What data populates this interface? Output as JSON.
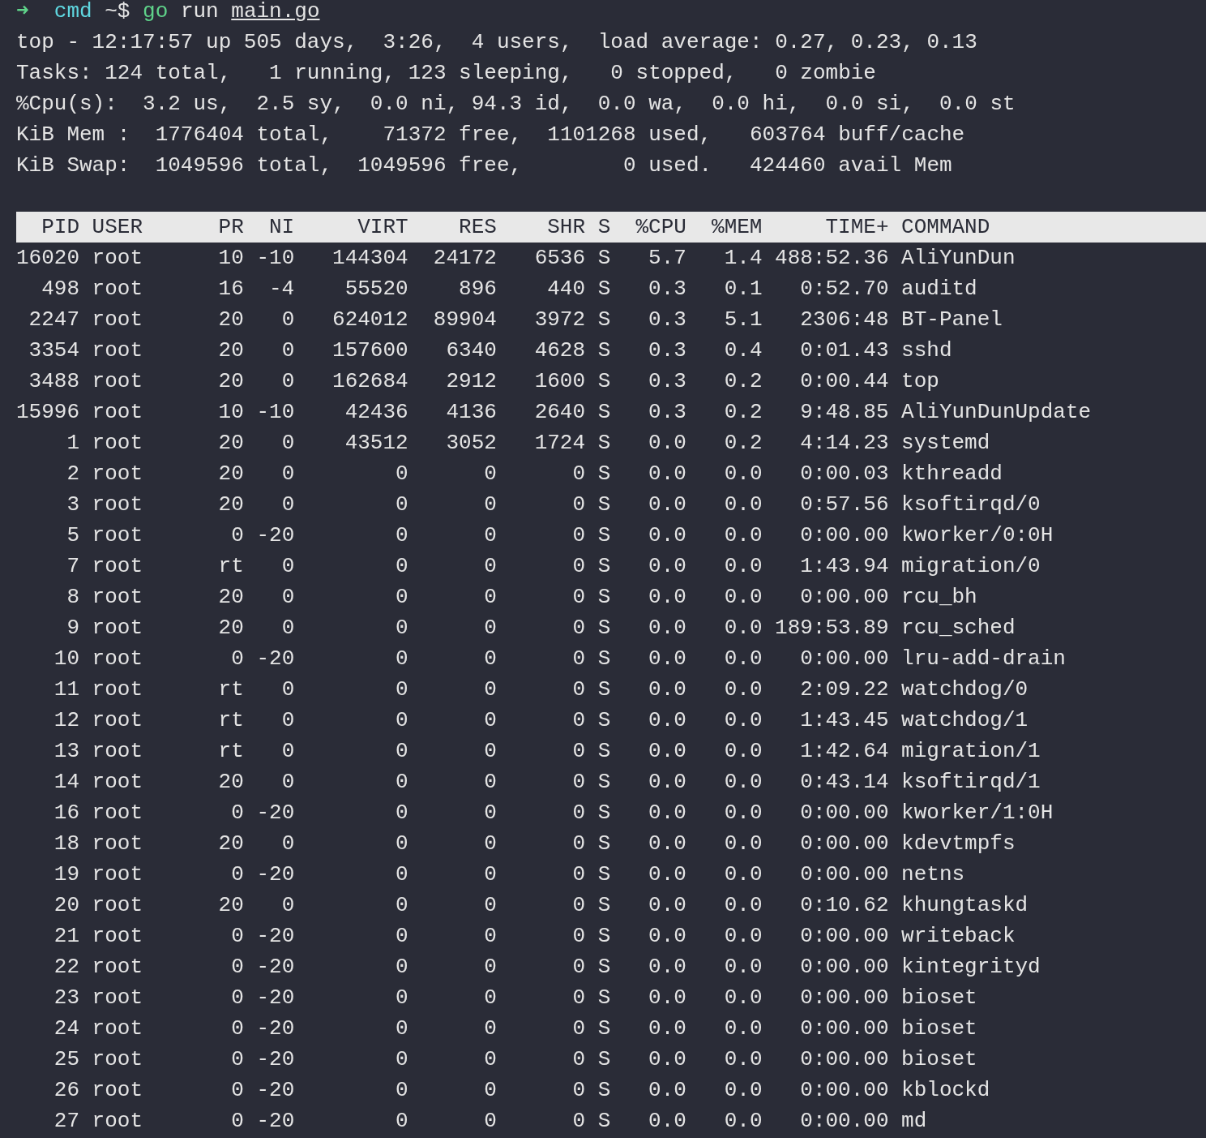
{
  "prompt": {
    "arrow": "➜",
    "directory": "cmd",
    "symbol": "~$",
    "command": "go",
    "argument": "run",
    "file": "main.go"
  },
  "summary": [
    "top - 12:17:57 up 505 days,  3:26,  4 users,  load average: 0.27, 0.23, 0.13",
    "Tasks: 124 total,   1 running, 123 sleeping,   0 stopped,   0 zombie",
    "%Cpu(s):  3.2 us,  2.5 sy,  0.0 ni, 94.3 id,  0.0 wa,  0.0 hi,  0.0 si,  0.0 st",
    "KiB Mem :  1776404 total,    71372 free,  1101268 used,   603764 buff/cache",
    "KiB Swap:  1049596 total,  1049596 free,        0 used.   424460 avail Mem"
  ],
  "table": {
    "columns": [
      "PID",
      "USER",
      "PR",
      "NI",
      "VIRT",
      "RES",
      "SHR",
      "S",
      "%CPU",
      "%MEM",
      "TIME+",
      "COMMAND"
    ],
    "rows": [
      [
        "16020",
        "root",
        "10",
        "-10",
        "144304",
        "24172",
        "6536",
        "S",
        "5.7",
        "1.4",
        "488:52.36",
        "AliYunDun"
      ],
      [
        "498",
        "root",
        "16",
        "-4",
        "55520",
        "896",
        "440",
        "S",
        "0.3",
        "0.1",
        "0:52.70",
        "auditd"
      ],
      [
        "2247",
        "root",
        "20",
        "0",
        "624012",
        "89904",
        "3972",
        "S",
        "0.3",
        "5.1",
        "2306:48",
        "BT-Panel"
      ],
      [
        "3354",
        "root",
        "20",
        "0",
        "157600",
        "6340",
        "4628",
        "S",
        "0.3",
        "0.4",
        "0:01.43",
        "sshd"
      ],
      [
        "3488",
        "root",
        "20",
        "0",
        "162684",
        "2912",
        "1600",
        "S",
        "0.3",
        "0.2",
        "0:00.44",
        "top"
      ],
      [
        "15996",
        "root",
        "10",
        "-10",
        "42436",
        "4136",
        "2640",
        "S",
        "0.3",
        "0.2",
        "9:48.85",
        "AliYunDunUpdate"
      ],
      [
        "1",
        "root",
        "20",
        "0",
        "43512",
        "3052",
        "1724",
        "S",
        "0.0",
        "0.2",
        "4:14.23",
        "systemd"
      ],
      [
        "2",
        "root",
        "20",
        "0",
        "0",
        "0",
        "0",
        "S",
        "0.0",
        "0.0",
        "0:00.03",
        "kthreadd"
      ],
      [
        "3",
        "root",
        "20",
        "0",
        "0",
        "0",
        "0",
        "S",
        "0.0",
        "0.0",
        "0:57.56",
        "ksoftirqd/0"
      ],
      [
        "5",
        "root",
        "0",
        "-20",
        "0",
        "0",
        "0",
        "S",
        "0.0",
        "0.0",
        "0:00.00",
        "kworker/0:0H"
      ],
      [
        "7",
        "root",
        "rt",
        "0",
        "0",
        "0",
        "0",
        "S",
        "0.0",
        "0.0",
        "1:43.94",
        "migration/0"
      ],
      [
        "8",
        "root",
        "20",
        "0",
        "0",
        "0",
        "0",
        "S",
        "0.0",
        "0.0",
        "0:00.00",
        "rcu_bh"
      ],
      [
        "9",
        "root",
        "20",
        "0",
        "0",
        "0",
        "0",
        "S",
        "0.0",
        "0.0",
        "189:53.89",
        "rcu_sched"
      ],
      [
        "10",
        "root",
        "0",
        "-20",
        "0",
        "0",
        "0",
        "S",
        "0.0",
        "0.0",
        "0:00.00",
        "lru-add-drain"
      ],
      [
        "11",
        "root",
        "rt",
        "0",
        "0",
        "0",
        "0",
        "S",
        "0.0",
        "0.0",
        "2:09.22",
        "watchdog/0"
      ],
      [
        "12",
        "root",
        "rt",
        "0",
        "0",
        "0",
        "0",
        "S",
        "0.0",
        "0.0",
        "1:43.45",
        "watchdog/1"
      ],
      [
        "13",
        "root",
        "rt",
        "0",
        "0",
        "0",
        "0",
        "S",
        "0.0",
        "0.0",
        "1:42.64",
        "migration/1"
      ],
      [
        "14",
        "root",
        "20",
        "0",
        "0",
        "0",
        "0",
        "S",
        "0.0",
        "0.0",
        "0:43.14",
        "ksoftirqd/1"
      ],
      [
        "16",
        "root",
        "0",
        "-20",
        "0",
        "0",
        "0",
        "S",
        "0.0",
        "0.0",
        "0:00.00",
        "kworker/1:0H"
      ],
      [
        "18",
        "root",
        "20",
        "0",
        "0",
        "0",
        "0",
        "S",
        "0.0",
        "0.0",
        "0:00.00",
        "kdevtmpfs"
      ],
      [
        "19",
        "root",
        "0",
        "-20",
        "0",
        "0",
        "0",
        "S",
        "0.0",
        "0.0",
        "0:00.00",
        "netns"
      ],
      [
        "20",
        "root",
        "20",
        "0",
        "0",
        "0",
        "0",
        "S",
        "0.0",
        "0.0",
        "0:10.62",
        "khungtaskd"
      ],
      [
        "21",
        "root",
        "0",
        "-20",
        "0",
        "0",
        "0",
        "S",
        "0.0",
        "0.0",
        "0:00.00",
        "writeback"
      ],
      [
        "22",
        "root",
        "0",
        "-20",
        "0",
        "0",
        "0",
        "S",
        "0.0",
        "0.0",
        "0:00.00",
        "kintegrityd"
      ],
      [
        "23",
        "root",
        "0",
        "-20",
        "0",
        "0",
        "0",
        "S",
        "0.0",
        "0.0",
        "0:00.00",
        "bioset"
      ],
      [
        "24",
        "root",
        "0",
        "-20",
        "0",
        "0",
        "0",
        "S",
        "0.0",
        "0.0",
        "0:00.00",
        "bioset"
      ],
      [
        "25",
        "root",
        "0",
        "-20",
        "0",
        "0",
        "0",
        "S",
        "0.0",
        "0.0",
        "0:00.00",
        "bioset"
      ],
      [
        "26",
        "root",
        "0",
        "-20",
        "0",
        "0",
        "0",
        "S",
        "0.0",
        "0.0",
        "0:00.00",
        "kblockd"
      ],
      [
        "27",
        "root",
        "0",
        "-20",
        "0",
        "0",
        "0",
        "S",
        "0.0",
        "0.0",
        "0:00.00",
        "md"
      ]
    ]
  }
}
